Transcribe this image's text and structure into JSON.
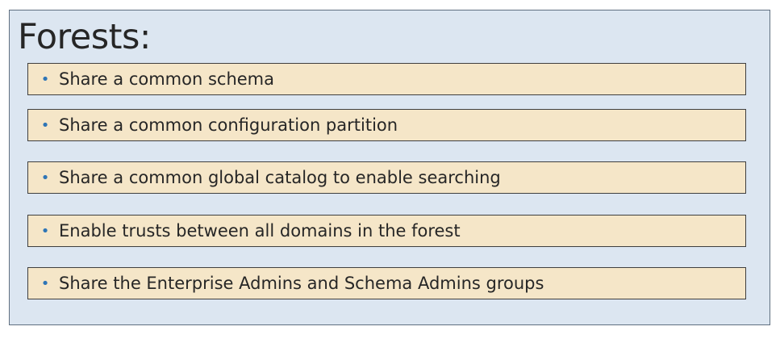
{
  "slide": {
    "title": "Forests:",
    "bullet_symbol": "•",
    "accent_color": "#2e75b6",
    "items": [
      "Share a common schema",
      "Share a common configuration partition",
      "Share a common global catalog to enable searching",
      "Enable trusts between all domains in the forest",
      "Share the Enterprise Admins and Schema Admins groups"
    ]
  }
}
